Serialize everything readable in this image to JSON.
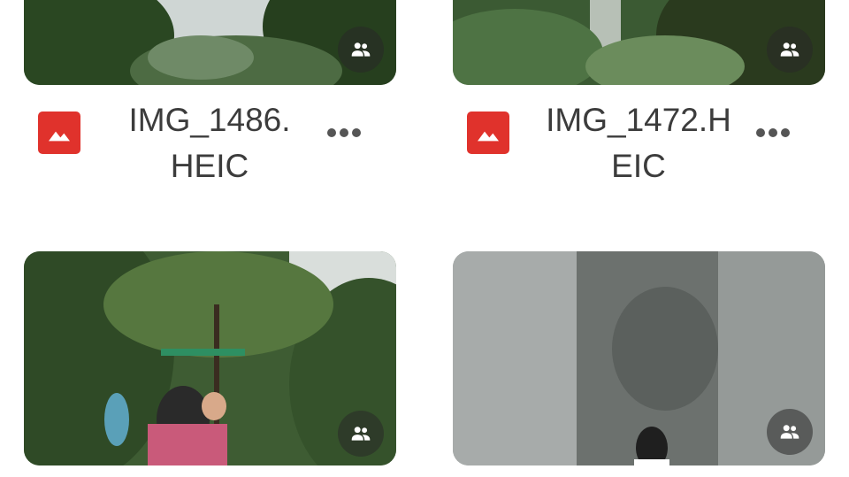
{
  "files": [
    {
      "name_line1": "IMG_1486.",
      "name_line2": "HEIC",
      "shared": true,
      "file_type_icon": "image-file-icon",
      "more_icon": "more-horizontal-icon"
    },
    {
      "name_line1": "IMG_1472.H",
      "name_line2": "EIC",
      "shared": true,
      "file_type_icon": "image-file-icon",
      "more_icon": "more-horizontal-icon"
    },
    {
      "name_line1": "",
      "name_line2": "",
      "shared": true,
      "file_type_icon": "image-file-icon",
      "more_icon": "more-horizontal-icon"
    },
    {
      "name_line1": "",
      "name_line2": "",
      "shared": true,
      "file_type_icon": "image-file-icon",
      "more_icon": "more-horizontal-icon"
    }
  ],
  "colors": {
    "file_icon_red": "#e0322c",
    "name_text": "#3c3c3c",
    "badge_bg": "#3a3a3a",
    "background": "#ffffff"
  },
  "icons": {
    "shared": "people-icon",
    "more": "more-horizontal-icon",
    "file_type": "image-file-icon"
  }
}
